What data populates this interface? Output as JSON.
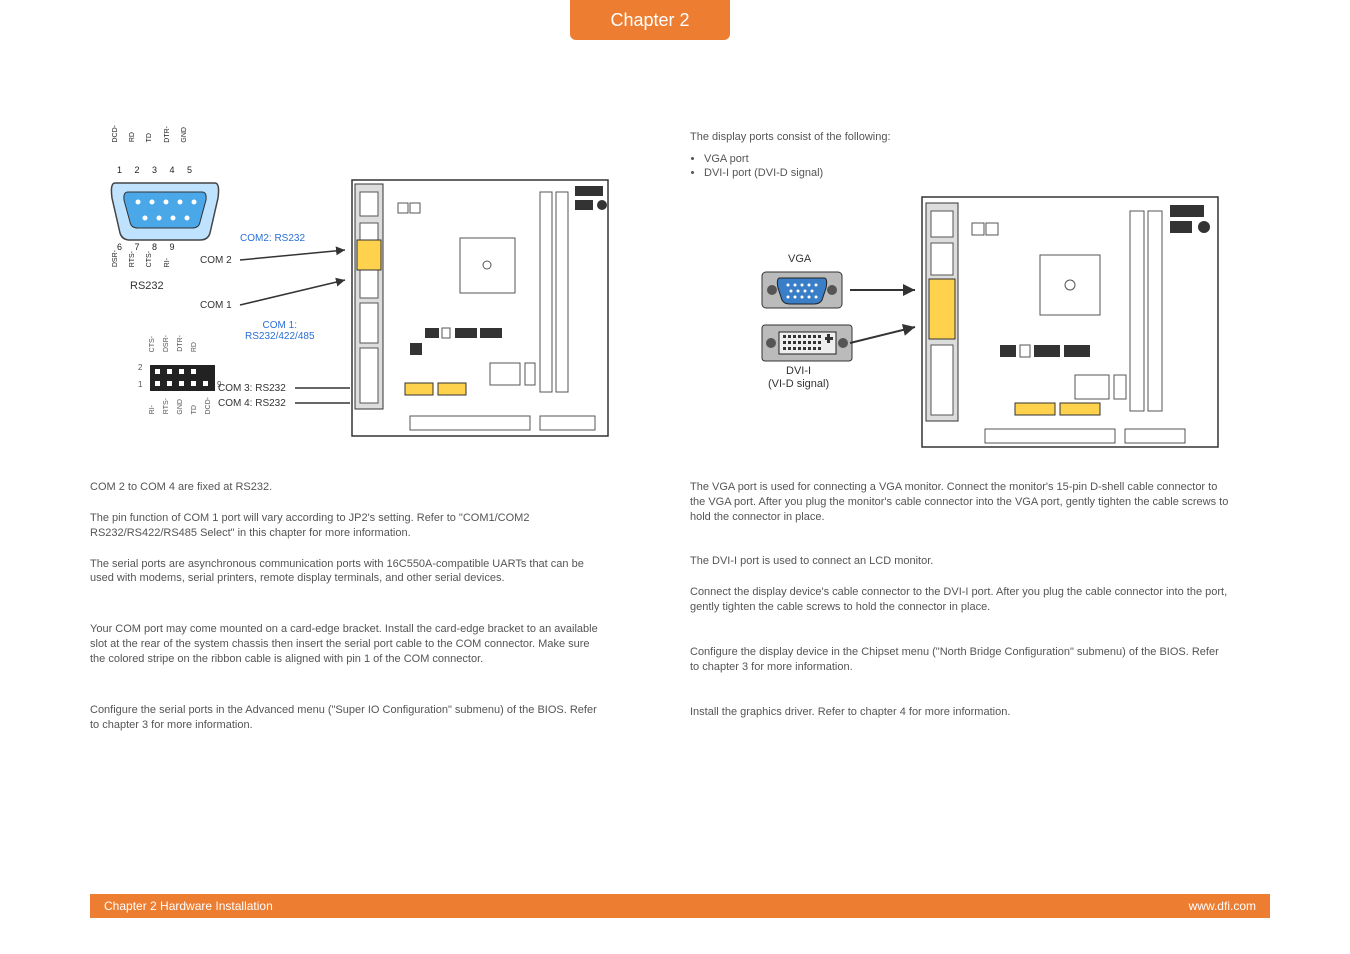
{
  "chapter_tab": "Chapter 2",
  "footer": {
    "left": "Chapter 2 Hardware Installation",
    "right": "www.dfi.com"
  },
  "left": {
    "diagram": {
      "top_pins": [
        "DCD-",
        "RD",
        "TD",
        "DTR-",
        "GND"
      ],
      "top_numbers": [
        "1",
        "2",
        "3",
        "4",
        "5"
      ],
      "bottom_numbers": [
        "6",
        "7",
        "8",
        "9"
      ],
      "bottom_pins": [
        "DSR-",
        "RTS-",
        "CTS-",
        "RI-"
      ],
      "rs232": "RS232",
      "com2_blue": "COM2: RS232",
      "com2_label": "COM 2",
      "com1_label": "COM 1",
      "com1_blue_l1": "COM 1:",
      "com1_blue_l2": "RS232/422/485",
      "com3": "COM 3: RS232",
      "com4": "COM 4: RS232",
      "header_top_pins": [
        "CTS-",
        "DSR-",
        "DTR-",
        "RD"
      ],
      "header_bottom_pins": [
        "RI-",
        "RTS-",
        "GND",
        "TD",
        "DCD-"
      ],
      "header_left_top": "2",
      "header_left_bottom": "1",
      "header_right": "9"
    },
    "p1": "COM 2 to COM 4 are fixed at RS232.",
    "p2": "The pin function of COM 1 port will vary according to JP2's setting. Refer to \"COM1/COM2 RS232/RS422/RS485 Select\" in this chapter for more information.",
    "p3": "The serial ports are asynchronous communication ports with 16C550A-compatible UARTs that can be used with modems, serial printers, remote display terminals, and other serial devices.",
    "p4": "Your COM port may come mounted on a card-edge bracket. Install the card-edge bracket to an available slot at the rear of the system chassis then insert the serial port cable to the COM connector. Make sure the colored stripe on the ribbon cable is aligned with pin 1 of the COM connector.",
    "p5": "Configure the serial ports in the Advanced menu (\"Super IO Configuration\" submenu) of the BIOS. Refer to chapter 3 for more information."
  },
  "right": {
    "intro": "The display ports consist of the following:",
    "bullets": [
      "VGA port",
      "DVI-I port (DVI-D signal)"
    ],
    "vga_label": "VGA",
    "dvi_label_l1": "DVI-I",
    "dvi_label_l2": "(VI-D signal)",
    "p1": "The VGA port is used for connecting a VGA monitor. Connect the monitor's 15-pin D-shell cable connector to the VGA port. After you plug the monitor's cable connector into the VGA port, gently tighten the cable screws to hold the connector in place.",
    "p2": "The DVI-I port is used to connect an LCD monitor.",
    "p3": "Connect the display device's cable connector to the DVI-I port. After you plug the cable connector into the port, gently tighten the cable screws to hold the connector in place.",
    "p4": "Configure the display device in the Chipset menu (\"North Bridge Configuration\" submenu) of the BIOS. Refer to chapter 3 for more information.",
    "p5": "Install the graphics driver. Refer to chapter 4 for more information."
  }
}
